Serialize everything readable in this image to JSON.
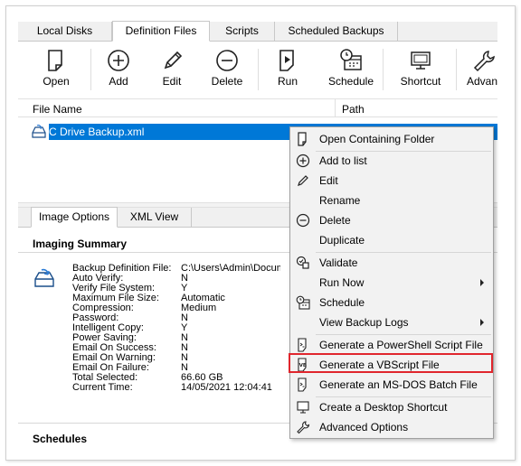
{
  "tabs": [
    "Local Disks",
    "Definition Files",
    "Scripts",
    "Scheduled Backups"
  ],
  "toolbar": {
    "open": "Open",
    "add": "Add",
    "edit": "Edit",
    "delete": "Delete",
    "run": "Run",
    "schedule": "Schedule",
    "shortcut": "Shortcut",
    "advanced": "Advan"
  },
  "list": {
    "col_file_name": "File Name",
    "col_path": "Path",
    "selected_file": "C Drive Backup.xml"
  },
  "subtabs": [
    "Image Options",
    "XML View"
  ],
  "summary": {
    "title": "Imaging Summary",
    "rows": [
      {
        "k": "Backup Definition File:",
        "v": "C:\\Users\\Admin\\Documents\\Reflect\\C Drive Backup.xml"
      },
      {
        "k": "Auto Verify:",
        "v": "N"
      },
      {
        "k": "Verify File System:",
        "v": "Y"
      },
      {
        "k": "Maximum File Size:",
        "v": "Automatic"
      },
      {
        "k": "Compression:",
        "v": "Medium"
      },
      {
        "k": "Password:",
        "v": "N"
      },
      {
        "k": "Intelligent Copy:",
        "v": "Y"
      },
      {
        "k": "Power Saving:",
        "v": "N"
      },
      {
        "k": "Email On Success:",
        "v": "N"
      },
      {
        "k": "Email On Warning:",
        "v": "N"
      },
      {
        "k": "Email On Failure:",
        "v": "N"
      },
      {
        "k": "Total Selected:",
        "v": "66.60 GB"
      },
      {
        "k": "Current Time:",
        "v": "14/05/2021 12:04:41"
      }
    ]
  },
  "schedules_title": "Schedules",
  "context_menu": {
    "open_folder": "Open Containing Folder",
    "add_to_list": "Add to list",
    "edit": "Edit",
    "rename": "Rename",
    "delete": "Delete",
    "duplicate": "Duplicate",
    "validate": "Validate",
    "run_now": "Run Now",
    "schedule": "Schedule",
    "view_logs": "View Backup Logs",
    "gen_ps": "Generate a PowerShell Script File",
    "gen_vbs": "Generate a VBScript File",
    "gen_bat": "Generate an MS-DOS Batch File",
    "create_shortcut": "Create a Desktop Shortcut",
    "advanced": "Advanced Options"
  },
  "colors": {
    "selection": "#0078d7",
    "highlight_box": "#e0262d"
  }
}
